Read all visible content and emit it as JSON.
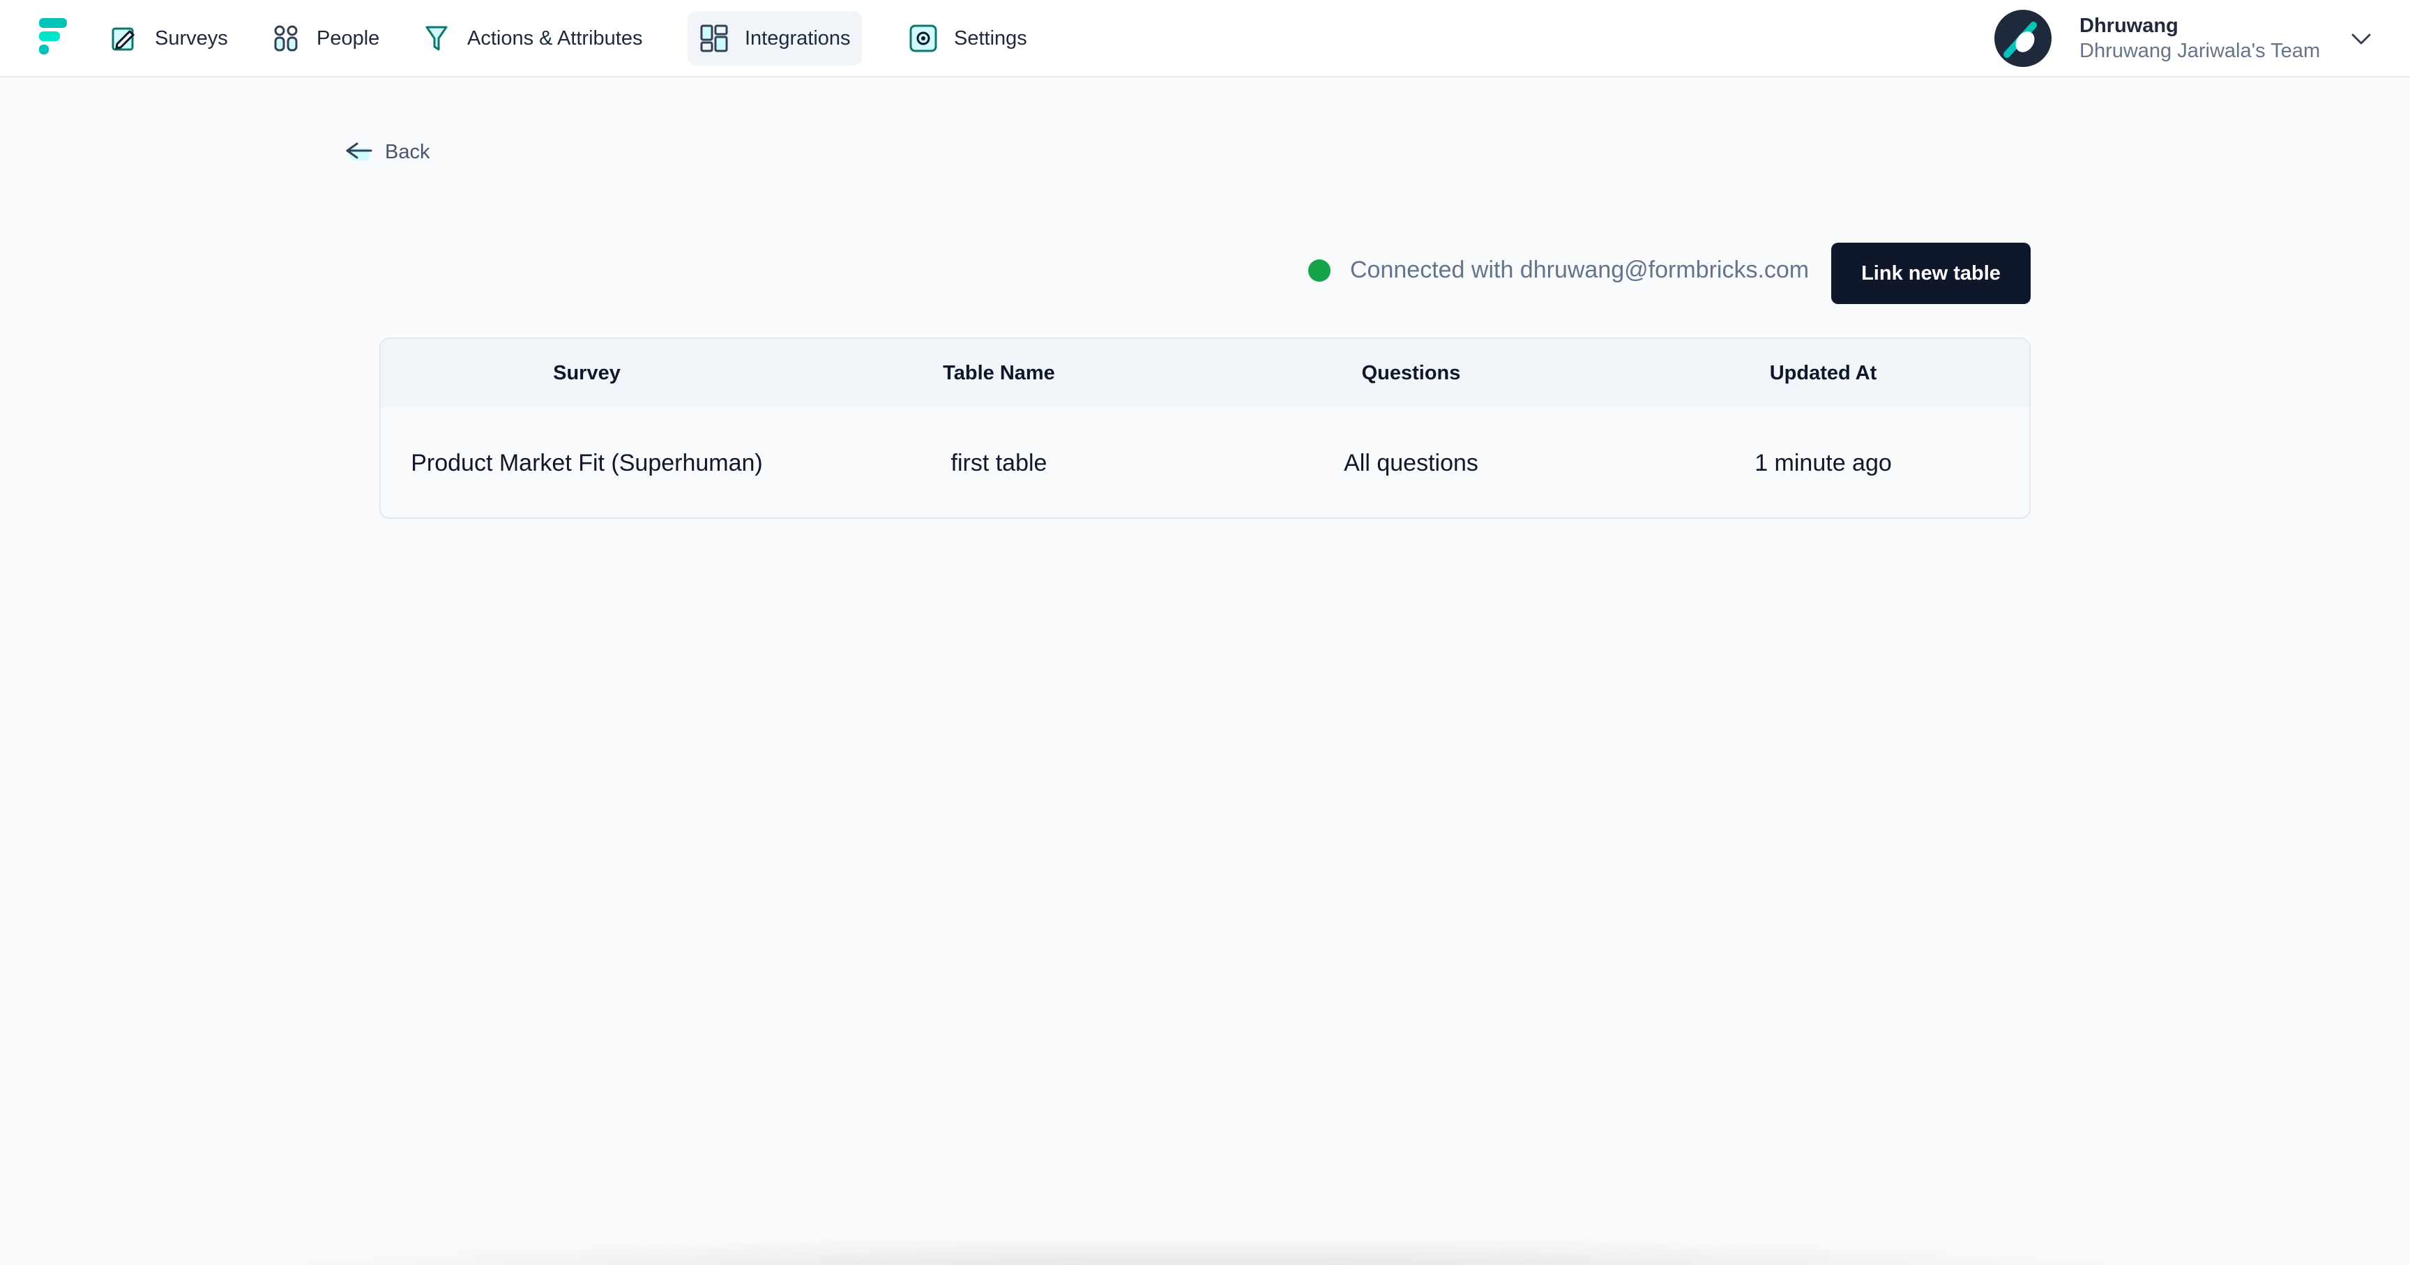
{
  "nav": {
    "items": [
      {
        "label": "Surveys",
        "icon": "survey-icon"
      },
      {
        "label": "People",
        "icon": "people-icon"
      },
      {
        "label": "Actions & Attributes",
        "icon": "filter-icon"
      },
      {
        "label": "Integrations",
        "icon": "integrations-icon",
        "active": true
      },
      {
        "label": "Settings",
        "icon": "settings-icon"
      }
    ]
  },
  "account": {
    "name": "Dhruwang",
    "team": "Dhruwang Jariwala's Team"
  },
  "back_label": "Back",
  "connection": {
    "status_text": "Connected with dhruwang@formbricks.com",
    "status_color": "#16a34a"
  },
  "link_button_label": "Link new table",
  "table": {
    "columns": [
      "Survey",
      "Table Name",
      "Questions",
      "Updated At"
    ],
    "rows": [
      [
        "Product Market Fit (Superhuman)",
        "first table",
        "All questions",
        "1 minute ago"
      ]
    ]
  },
  "colors": {
    "brand": "#00C4B8",
    "primary_button": "#0f172a"
  }
}
